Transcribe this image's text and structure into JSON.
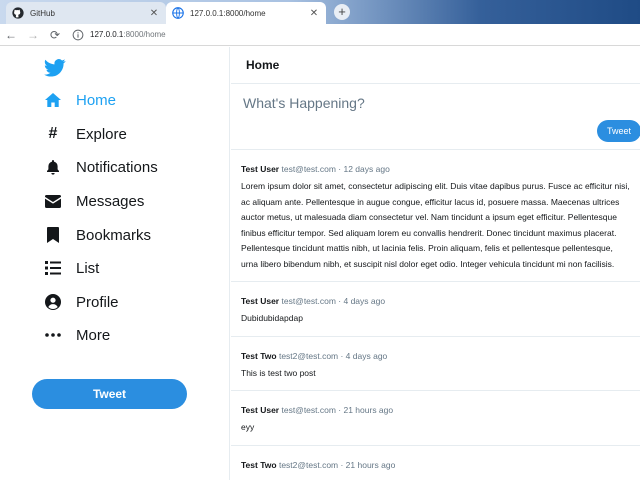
{
  "browser": {
    "tabs": [
      {
        "title": "GitHub",
        "icon": "github-icon",
        "active": false
      },
      {
        "title": "127.0.0.1:8000/home",
        "icon": "page-icon",
        "active": true
      }
    ],
    "new_tab_label": "+",
    "url": {
      "host": "127.0.0.1",
      "path": ":8000/home"
    }
  },
  "sidebar": {
    "logo": "twitter-bird-icon",
    "items": [
      {
        "label": "Home",
        "icon": "home-icon",
        "active": true
      },
      {
        "label": "Explore",
        "icon": "hashtag-icon",
        "active": false
      },
      {
        "label": "Notifications",
        "icon": "bell-icon",
        "active": false
      },
      {
        "label": "Messages",
        "icon": "envelope-icon",
        "active": false
      },
      {
        "label": "Bookmarks",
        "icon": "bookmark-icon",
        "active": false
      },
      {
        "label": "List",
        "icon": "list-icon",
        "active": false
      },
      {
        "label": "Profile",
        "icon": "user-circle-icon",
        "active": false
      },
      {
        "label": "More",
        "icon": "more-dots-icon",
        "active": false
      }
    ],
    "tweet_button": "Tweet"
  },
  "main": {
    "title": "Home",
    "compose_placeholder": "What's Happening?",
    "tweet_button": "Tweet",
    "posts": [
      {
        "name": "Test User",
        "meta": "test@test.com · 12 days ago",
        "text": "Lorem ipsum dolor sit amet, consectetur adipiscing elit. Duis vitae dapibus purus. Fusce ac efficitur nisi, ac aliquam ante. Pellentesque in augue congue, efficitur lacus id, posuere massa. Maecenas ultrices auctor metus, ut malesuada diam consectetur vel. Nam tincidunt a ipsum eget efficitur. Pellentesque finibus efficitur tempor. Sed aliquam lorem eu convallis hendrerit. Donec tincidunt maximus placerat. Pellentesque tincidunt mattis nibh, ut lacinia felis. Proin aliquam, felis et pellentesque pellentesque, urna libero bibendum nibh, et suscipit nisl dolor eget odio. Integer vehicula tincidunt mi non facilisis."
      },
      {
        "name": "Test User",
        "meta": "test@test.com · 4 days ago",
        "text": "Dubidubidapdap"
      },
      {
        "name": "Test Two",
        "meta": "test2@test.com · 4 days ago",
        "text": "This is test two post"
      },
      {
        "name": "Test User",
        "meta": "test@test.com · 21 hours ago",
        "text": "eyy"
      },
      {
        "name": "Test Two",
        "meta": "test2@test.com · 21 hours ago",
        "text": ""
      }
    ]
  },
  "colors": {
    "accent": "#1da1f2",
    "button": "#2b8ee0",
    "border": "#e6ecf0",
    "muted": "#657786"
  }
}
